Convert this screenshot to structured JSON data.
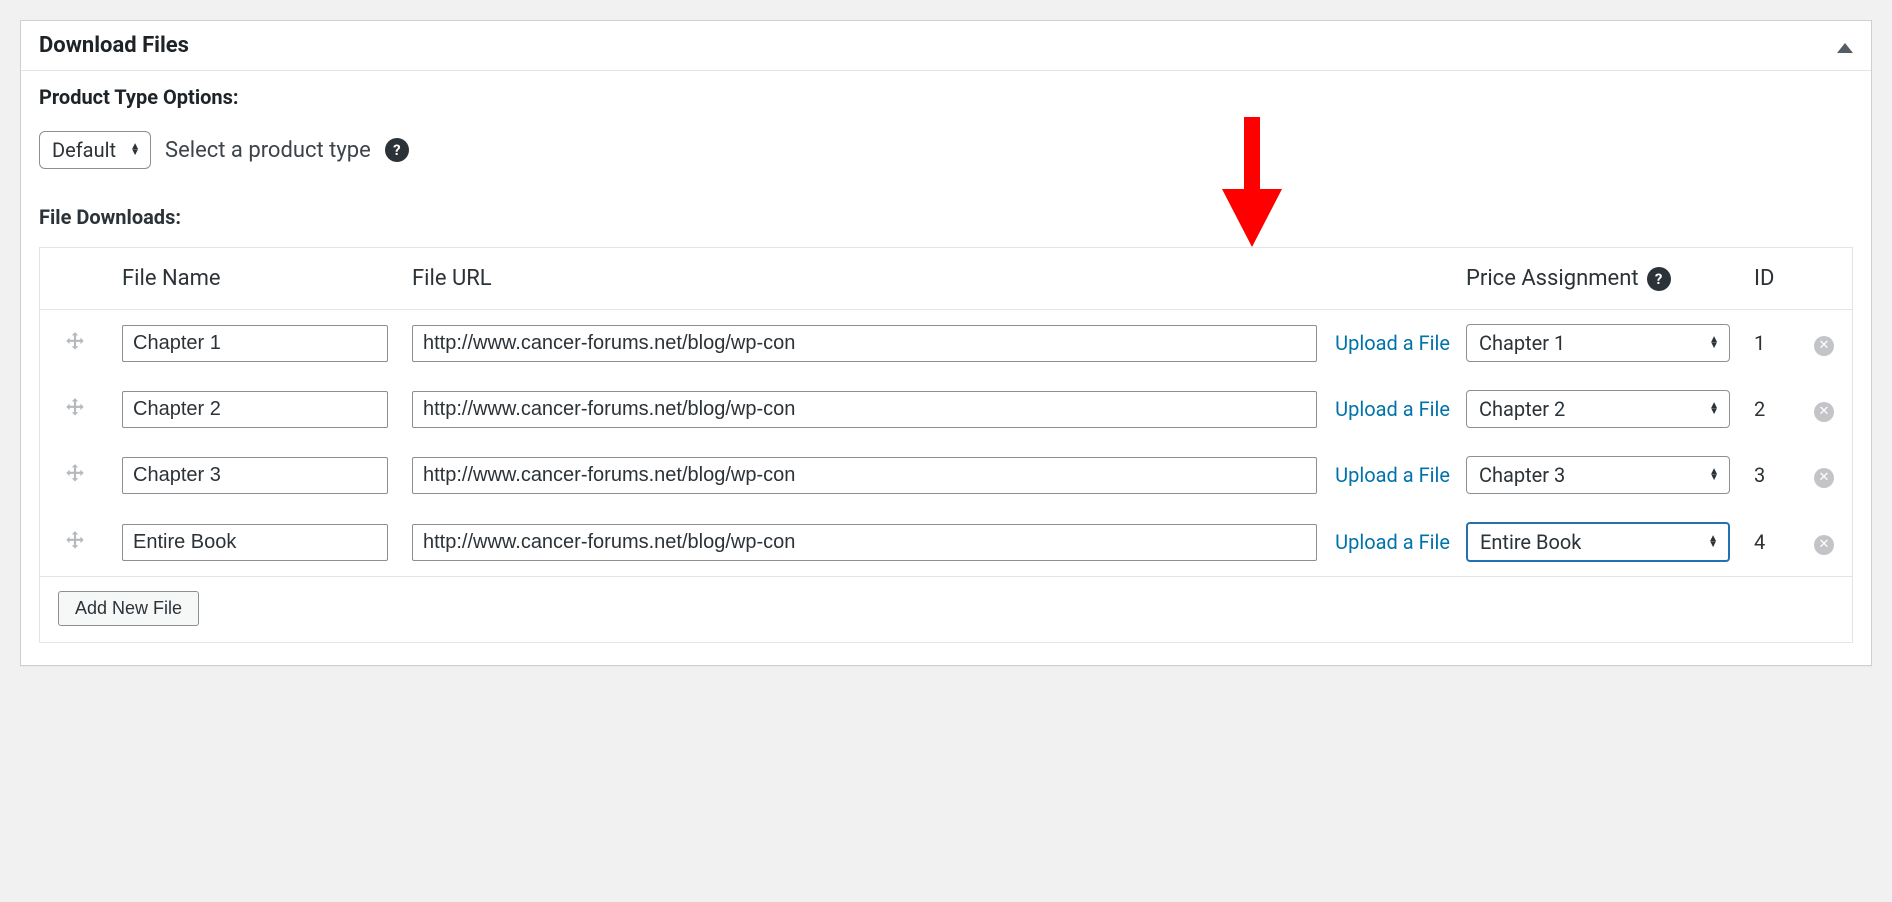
{
  "panel": {
    "title": "Download Files"
  },
  "product_type": {
    "label": "Product Type Options:",
    "select_value": "Default",
    "helper_text": "Select a product type"
  },
  "file_downloads": {
    "label": "File Downloads:",
    "columns": {
      "file_name": "File Name",
      "file_url": "File URL",
      "price_assignment": "Price Assignment",
      "id": "ID"
    },
    "upload_label": "Upload a File",
    "add_button_label": "Add New File",
    "rows": [
      {
        "name": "Chapter 1",
        "url": "http://www.cancer-forums.net/blog/wp-con",
        "price": "Chapter 1",
        "id": "1",
        "focused": false
      },
      {
        "name": "Chapter 2",
        "url": "http://www.cancer-forums.net/blog/wp-con",
        "price": "Chapter 2",
        "id": "2",
        "focused": false
      },
      {
        "name": "Chapter 3",
        "url": "http://www.cancer-forums.net/blog/wp-con",
        "price": "Chapter 3",
        "id": "3",
        "focused": false
      },
      {
        "name": "Entire Book",
        "url": "http://www.cancer-forums.net/blog/wp-con",
        "price": "Entire Book",
        "id": "4",
        "focused": true
      }
    ]
  },
  "annotation": {
    "arrow_color": "#ff0000"
  }
}
